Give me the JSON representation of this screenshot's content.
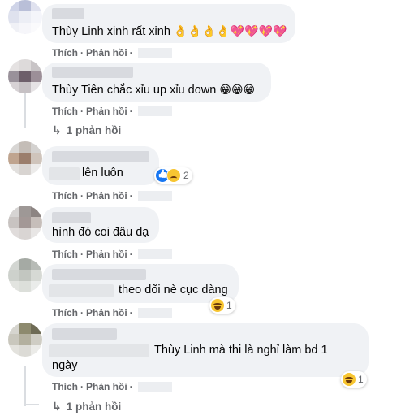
{
  "labels": {
    "like": "Thích",
    "reply": "Phản hồi",
    "separator": "·"
  },
  "comments": [
    {
      "text": "Thùy Linh xinh rất xinh",
      "emoji": "👌👌👌👌💖💖💖💖"
    },
    {
      "text": "Thùy Tiên chắc xỉu up xỉu down",
      "emoji": "😁😁😁"
    },
    {
      "text": "lên luôn",
      "reaction_count": "2"
    },
    {
      "text": "hình đó coi đâu dạ"
    },
    {
      "text": "theo dõi nè cục dàng",
      "reaction_count": "1"
    },
    {
      "text_line1": "Thùy Linh mà thi là nghỉ làm bd 1",
      "text_line2": "ngày",
      "reaction_count": "1"
    }
  ],
  "reply_links": [
    {
      "label": "1 phản hồi",
      "icon": "reply-arrow-icon"
    },
    {
      "label": "1 phản hồi",
      "icon": "reply-arrow-icon"
    }
  ],
  "colors": {
    "bubble": "#f0f2f5",
    "meta_text": "#65676b",
    "text": "#050505"
  }
}
